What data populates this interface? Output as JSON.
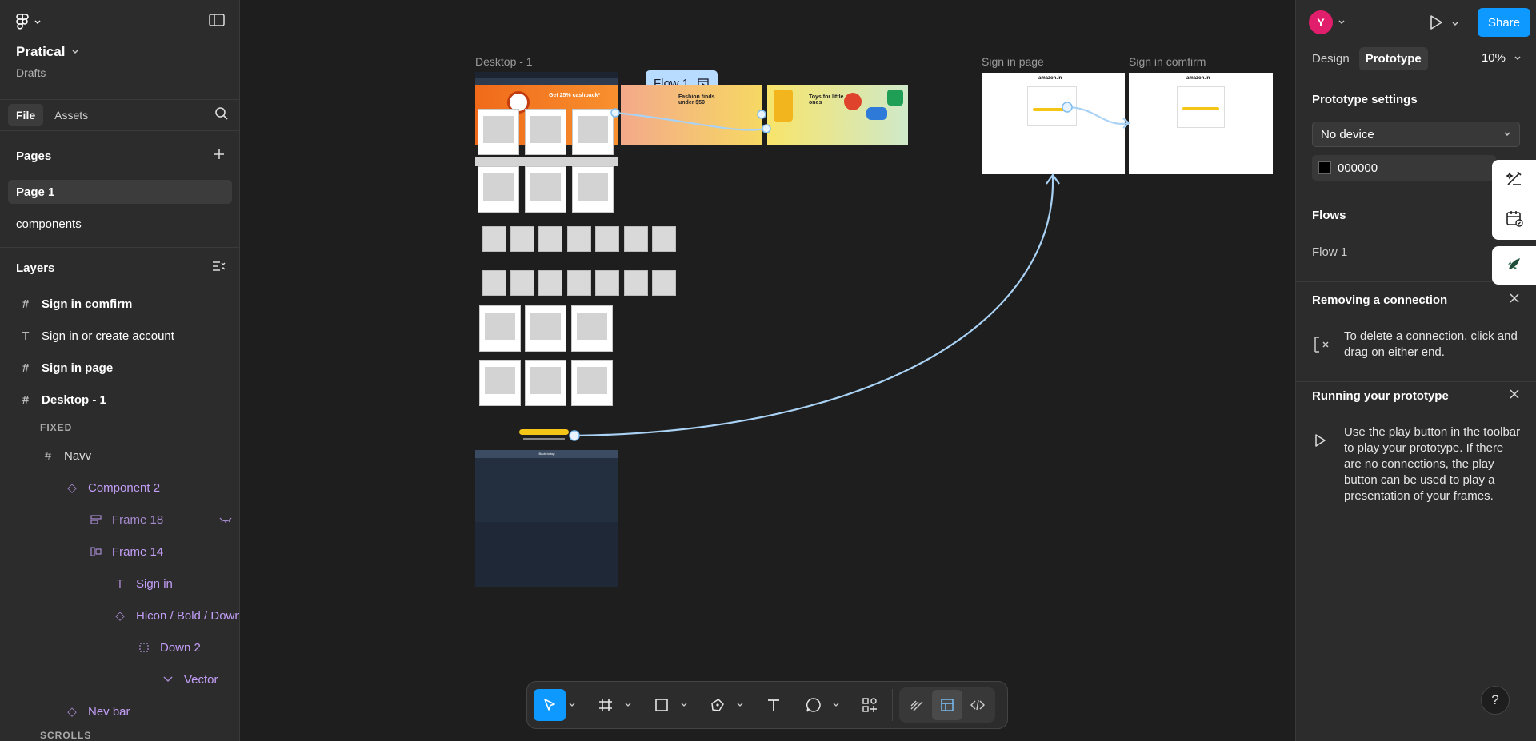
{
  "left_panel": {
    "project_name": "Pratical",
    "project_location": "Drafts",
    "tabs": [
      "File",
      "Assets"
    ],
    "pages_title": "Pages",
    "pages": [
      "Page 1",
      "components"
    ],
    "layers_title": "Layers",
    "layers": [
      {
        "label": "Sign in comfirm",
        "icon": "frame-icon"
      },
      {
        "label": "Sign in or create account",
        "icon": "text-icon"
      },
      {
        "label": "Sign in page",
        "icon": "frame-icon"
      },
      {
        "label": "Desktop - 1",
        "icon": "frame-icon"
      },
      {
        "label": "FIXED",
        "icon": ""
      },
      {
        "label": "Navv",
        "icon": "frame-icon"
      },
      {
        "label": "Component 2",
        "icon": "component-icon"
      },
      {
        "label": "Frame 18",
        "icon": "auto-layout-icon"
      },
      {
        "label": "Frame 14",
        "icon": "auto-layout-icon"
      },
      {
        "label": "Sign in",
        "icon": "text-icon"
      },
      {
        "label": "Hicon / Bold / Down",
        "icon": "component-icon"
      },
      {
        "label": "Down 2",
        "icon": "dashed-frame-icon"
      },
      {
        "label": "Vector",
        "icon": "chevron-down-icon"
      },
      {
        "label": "Nev bar",
        "icon": "component-icon"
      },
      {
        "label": "SCROLLS",
        "icon": ""
      }
    ]
  },
  "canvas": {
    "flow_chip": "Flow 1",
    "frame_labels": {
      "desktop": "Desktop - 1",
      "sign_in_page": "Sign in page",
      "sign_in_confirm": "Sign in comfirm"
    },
    "banner_texts": [
      "Get 25% cashback*",
      "Fashion finds under $50",
      "Toys for little ones"
    ],
    "amazon_logo": "amazon.in",
    "footer_heading": "Back to top"
  },
  "toolbar": {
    "tools": [
      "move-tool",
      "frame-tool",
      "shape-tool",
      "pen-tool",
      "text-tool",
      "comment-tool",
      "actions-tool"
    ],
    "modes": [
      "draw-mode",
      "design-mode",
      "dev-mode"
    ]
  },
  "right_panel": {
    "avatar_initial": "Y",
    "share_label": "Share",
    "tabs": [
      "Design",
      "Prototype"
    ],
    "zoom": "10%",
    "prototype_settings_title": "Prototype settings",
    "device": "No device",
    "background_color": "000000",
    "flows_title": "Flows",
    "flow_name": "Flow 1",
    "removing_title": "Removing a connection",
    "removing_text": "To delete a connection, click and drag on either end.",
    "running_title": "Running your prototype",
    "running_text": "Use the play button in the toolbar to play your prototype. If there are no connections, the play button can be used to play a presentation of your frames.",
    "help": "?"
  },
  "colors": {
    "accent": "#0d99ff",
    "flow_chip": "#b7dcff",
    "connector": "#a9d2f5",
    "avatar": "#e11e6b",
    "component_purple": "#c39ef7"
  }
}
